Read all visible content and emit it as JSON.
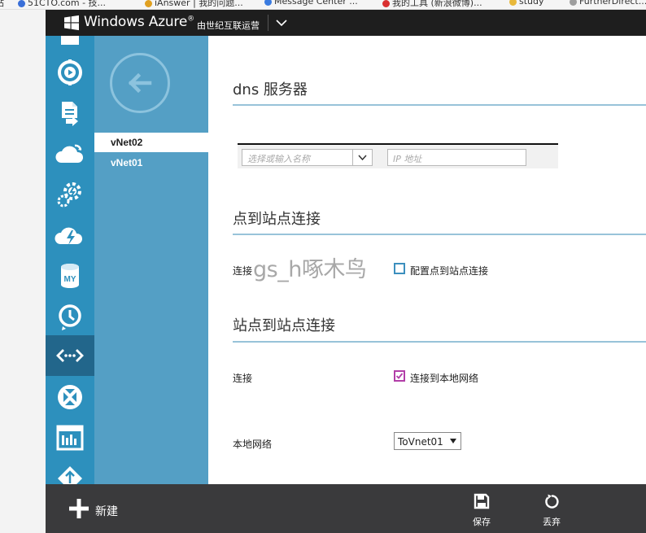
{
  "browser": {
    "bookmarks": [
      {
        "label": "站",
        "color": "#9e9e9e"
      },
      {
        "label": "51CTO.com - 技...",
        "color": "#3a6fd8"
      },
      {
        "label": "iAnswer | 我的问题...",
        "color": "#e0a020"
      },
      {
        "label": "Message Center ...",
        "color": "#3a7be0"
      },
      {
        "label": "我的工具 (新浪微博)...",
        "color": "#d93030"
      },
      {
        "label": "study",
        "color": "#e8b83a"
      },
      {
        "label": "FurtherDirect...",
        "color": "#9e9e9e"
      }
    ]
  },
  "topbar": {
    "brand": "Windows Azure",
    "brand_mark": "®",
    "operator": "由世纪互联运营"
  },
  "rail": {
    "items": [
      {
        "icon": "puzzle-icon"
      },
      {
        "icon": "media-services-icon"
      },
      {
        "icon": "storage-export-icon"
      },
      {
        "icon": "cloud-services-icon"
      },
      {
        "icon": "hdinsight-icon"
      },
      {
        "icon": "mobile-services-icon"
      },
      {
        "icon": "mysql-icon",
        "text": "MY"
      },
      {
        "icon": "scheduler-icon"
      },
      {
        "icon": "networks-icon"
      },
      {
        "icon": "traffic-manager-icon"
      },
      {
        "icon": "management-portal-icon"
      },
      {
        "icon": "service-bus-icon"
      }
    ],
    "active_index": 8
  },
  "list": {
    "items": [
      {
        "label": "vNet02",
        "selected": true
      },
      {
        "label": "vNet01",
        "selected": false
      }
    ]
  },
  "main": {
    "dns": {
      "title": "dns 服务器",
      "name_placeholder": "选择或输入名称",
      "ip_placeholder": "IP 地址"
    },
    "p2s": {
      "title": "点到站点连接",
      "field_label": "连接",
      "checkbox_label": "配置点到站点连接",
      "checked": false
    },
    "s2s": {
      "title": "站点到站点连接",
      "field_label": "连接",
      "checkbox_label": "连接到本地网络",
      "checked": true,
      "local_network_label": "本地网络",
      "local_network_value": "ToVnet01"
    },
    "watermark": "gs_h啄木鸟"
  },
  "cmdbar": {
    "new_label": "新建",
    "save_label": "保存",
    "discard_label": "丢弃"
  },
  "colors": {
    "rail": "#2d90bd",
    "rail_active": "#22668b",
    "list_pane": "#549fc5",
    "section_rule": "#98c3d9",
    "checkbox_checked": "#b23ea8"
  }
}
